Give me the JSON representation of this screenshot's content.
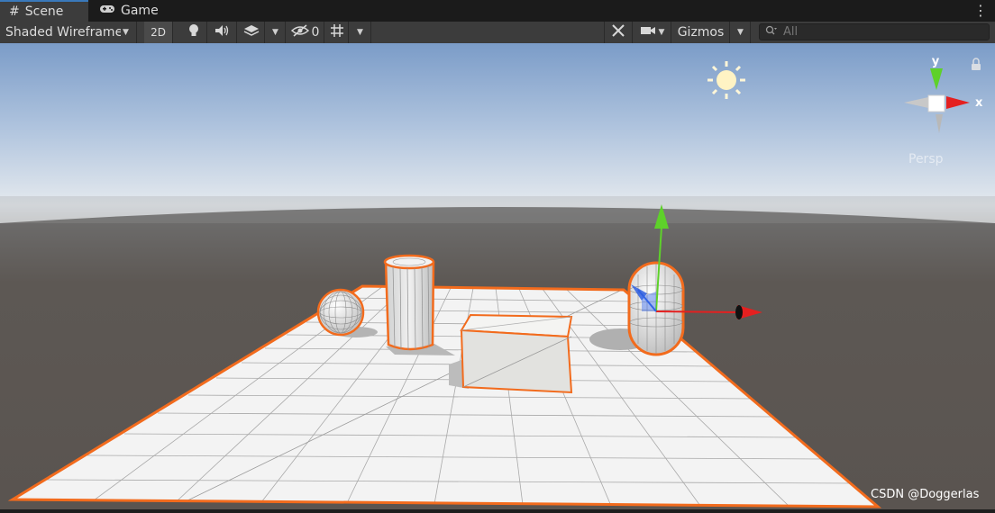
{
  "tabs": {
    "scene": {
      "label": "Scene",
      "icon": "hash-icon"
    },
    "game": {
      "label": "Game",
      "icon": "gamepad-icon"
    }
  },
  "toolbar": {
    "draw_mode": "Shaded Wireframe",
    "mode_2d": "2D",
    "hidden_count": "0",
    "gizmos": "Gizmos",
    "search_placeholder": "All"
  },
  "gizmo": {
    "y_label": "y",
    "x_label": "x",
    "projection": "Persp"
  },
  "watermark": "CSDN @Doggerlas",
  "colors": {
    "selection_outline": "#f26b1d",
    "axis_x": "#e42020",
    "axis_y": "#5ed12a",
    "axis_z": "#2f5fe0",
    "tab_accent": "#3a79bb"
  }
}
